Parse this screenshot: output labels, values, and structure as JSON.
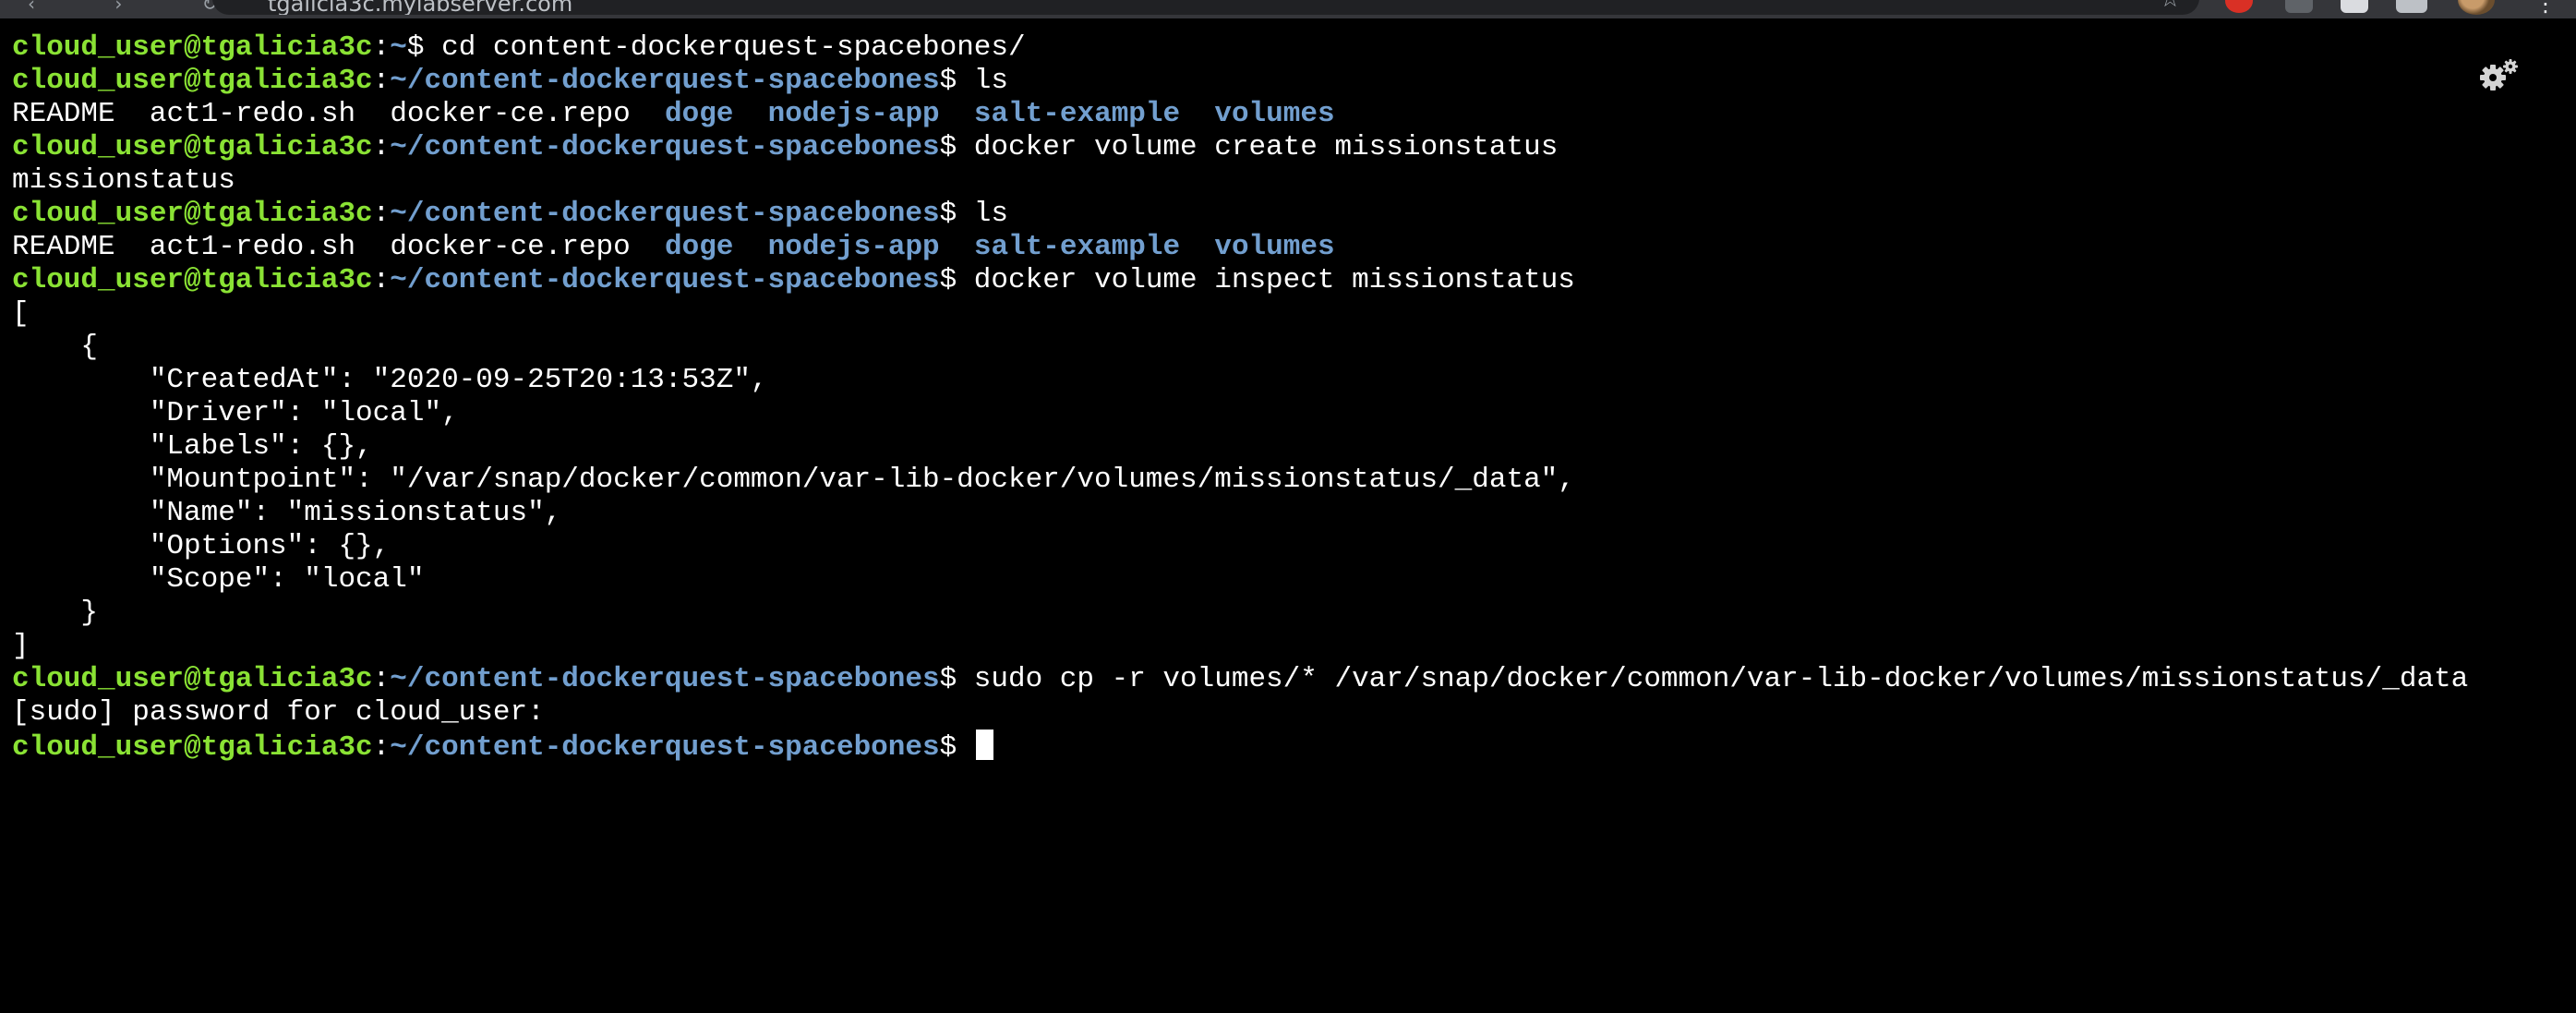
{
  "browser": {
    "url": "tgalicia3c.mylabserver.com"
  },
  "prompt": {
    "user_host": "cloud_user@tgalicia3c",
    "colon": ":",
    "home_path": "~",
    "project_path": "~/content-dockerquest-spacebones",
    "dollar": "$ "
  },
  "terminal": {
    "cmd_cd": "cd content-dockerquest-spacebones/",
    "cmd_ls": "ls",
    "ls_output": {
      "files": [
        "README",
        "act1-redo.sh",
        "docker-ce.repo"
      ],
      "dirs": [
        "doge",
        "nodejs-app",
        "salt-example",
        "volumes"
      ]
    },
    "cmd_create": "docker volume create missionstatus",
    "create_output": "missionstatus",
    "cmd_inspect": "docker volume inspect missionstatus",
    "inspect_output": [
      "[",
      "    {",
      "        \"CreatedAt\": \"2020-09-25T20:13:53Z\",",
      "        \"Driver\": \"local\",",
      "        \"Labels\": {},",
      "        \"Mountpoint\": \"/var/snap/docker/common/var-lib-docker/volumes/missionstatus/_data\",",
      "        \"Name\": \"missionstatus\",",
      "        \"Options\": {},",
      "        \"Scope\": \"local\"",
      "    }",
      "]"
    ],
    "cmd_cp": "sudo cp -r volumes/* /var/snap/docker/common/var-lib-docker/volumes/missionstatus/_data",
    "sudo_prompt": "[sudo] password for cloud_user:"
  },
  "icons": {
    "settings": "gears-icon",
    "nav_glyphs": "‹ › ↻",
    "star": "☆",
    "menu": "⋮"
  }
}
